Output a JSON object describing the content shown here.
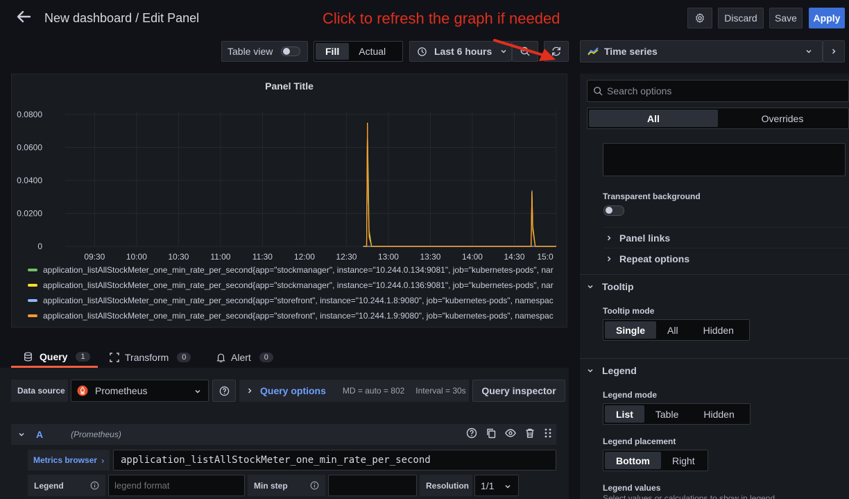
{
  "header": {
    "title": "New dashboard / Edit Panel",
    "annotation": "Click to refresh the graph if needed",
    "discard_label": "Discard",
    "save_label": "Save",
    "apply_label": "Apply"
  },
  "toolbar": {
    "table_view_label": "Table view",
    "fill_label": "Fill",
    "actual_label": "Actual",
    "time_range": "Last 6 hours",
    "visualization": "Time series"
  },
  "panel": {
    "title": "Panel Title",
    "legend": [
      {
        "label": "application_listAllStockMeter_one_min_rate_per_second{app=\"stockmanager\", instance=\"10.244.0.134:9081\", job=\"kubernetes-pods\", nar",
        "color": "#73bf69"
      },
      {
        "label": "application_listAllStockMeter_one_min_rate_per_second{app=\"stockmanager\", instance=\"10.244.0.136:9081\", job=\"kubernetes-pods\", nar",
        "color": "#fade2a"
      },
      {
        "label": "application_listAllStockMeter_one_min_rate_per_second{app=\"storefront\", instance=\"10.244.1.8:9080\", job=\"kubernetes-pods\", namespac",
        "color": "#8ab8ff"
      },
      {
        "label": "application_listAllStockMeter_one_min_rate_per_second{app=\"storefront\", instance=\"10.244.1.9:9080\", job=\"kubernetes-pods\", namespac",
        "color": "#ff9830"
      }
    ]
  },
  "chart_data": {
    "type": "line",
    "title": "Panel Title",
    "y_ticks": [
      "0.0800",
      "0.0600",
      "0.0400",
      "0.0200",
      "0"
    ],
    "ylim": [
      0,
      0.08
    ],
    "x_ticks": [
      "09:30",
      "10:00",
      "10:30",
      "11:00",
      "11:30",
      "12:00",
      "12:30",
      "13:00",
      "13:30",
      "14:00",
      "14:30",
      "15:0"
    ],
    "grid": true,
    "series": [
      {
        "color": "#73bf69",
        "points": [
          [
            12.7,
            0
          ],
          [
            12.74,
            0
          ],
          [
            12.75,
            0.07
          ],
          [
            12.76,
            0.045
          ],
          [
            12.77,
            0.01
          ],
          [
            12.8,
            0
          ],
          [
            14.7,
            0
          ],
          [
            14.71,
            0.034
          ],
          [
            14.72,
            0.01
          ],
          [
            14.75,
            0
          ],
          [
            15.0,
            0
          ]
        ]
      },
      {
        "color": "#fade2a",
        "points": [
          [
            12.7,
            0
          ],
          [
            12.74,
            0
          ],
          [
            12.75,
            0.075
          ],
          [
            12.76,
            0.028
          ],
          [
            12.77,
            0.008
          ],
          [
            12.8,
            0
          ],
          [
            14.7,
            0
          ],
          [
            14.71,
            0.033
          ],
          [
            14.72,
            0.012
          ],
          [
            14.75,
            0
          ],
          [
            15.0,
            0
          ]
        ]
      },
      {
        "color": "#8ab8ff",
        "points": [
          [
            12.7,
            0
          ],
          [
            15.0,
            0
          ]
        ]
      },
      {
        "color": "#ff9830",
        "points": [
          [
            12.7,
            0
          ],
          [
            12.74,
            0
          ],
          [
            12.75,
            0.074
          ],
          [
            12.76,
            0.027
          ],
          [
            12.77,
            0.006
          ],
          [
            12.8,
            0
          ],
          [
            14.7,
            0
          ],
          [
            14.71,
            0.032
          ],
          [
            14.72,
            0.01
          ],
          [
            14.75,
            0
          ],
          [
            15.0,
            0
          ]
        ]
      }
    ]
  },
  "tabs": {
    "query_label": "Query",
    "query_count": "1",
    "transform_label": "Transform",
    "transform_count": "0",
    "alert_label": "Alert",
    "alert_count": "0"
  },
  "query": {
    "datasource_label": "Data source",
    "datasource_value": "Prometheus",
    "query_options_label": "Query options",
    "md_text": "MD = auto = 802",
    "interval_text": "Interval = 30s",
    "inspector_label": "Query inspector",
    "row_letter": "A",
    "row_source": "(Prometheus)",
    "metrics_browser_label": "Metrics browser",
    "metric_expr": "application_listAllStockMeter_one_min_rate_per_second",
    "legend_label": "Legend",
    "legend_placeholder": "legend format",
    "min_step_label": "Min step",
    "resolution_label": "Resolution",
    "resolution_value": "1/1"
  },
  "options": {
    "search_placeholder": "Search options",
    "all_label": "All",
    "overrides_label": "Overrides",
    "transparent_label": "Transparent background",
    "panel_links_label": "Panel links",
    "repeat_options_label": "Repeat options",
    "tooltip_section": "Tooltip",
    "tooltip_mode_label": "Tooltip mode",
    "tooltip_modes": [
      "Single",
      "All",
      "Hidden"
    ],
    "legend_section": "Legend",
    "legend_mode_label": "Legend mode",
    "legend_modes": [
      "List",
      "Table",
      "Hidden"
    ],
    "legend_placement_label": "Legend placement",
    "legend_placements": [
      "Bottom",
      "Right"
    ],
    "legend_values_label": "Legend values",
    "legend_values_desc": "Select values or calculations to show in legend"
  },
  "colors": {
    "accent": "#3d71d9",
    "annotation": "#e02f1f",
    "background": "#111217"
  }
}
